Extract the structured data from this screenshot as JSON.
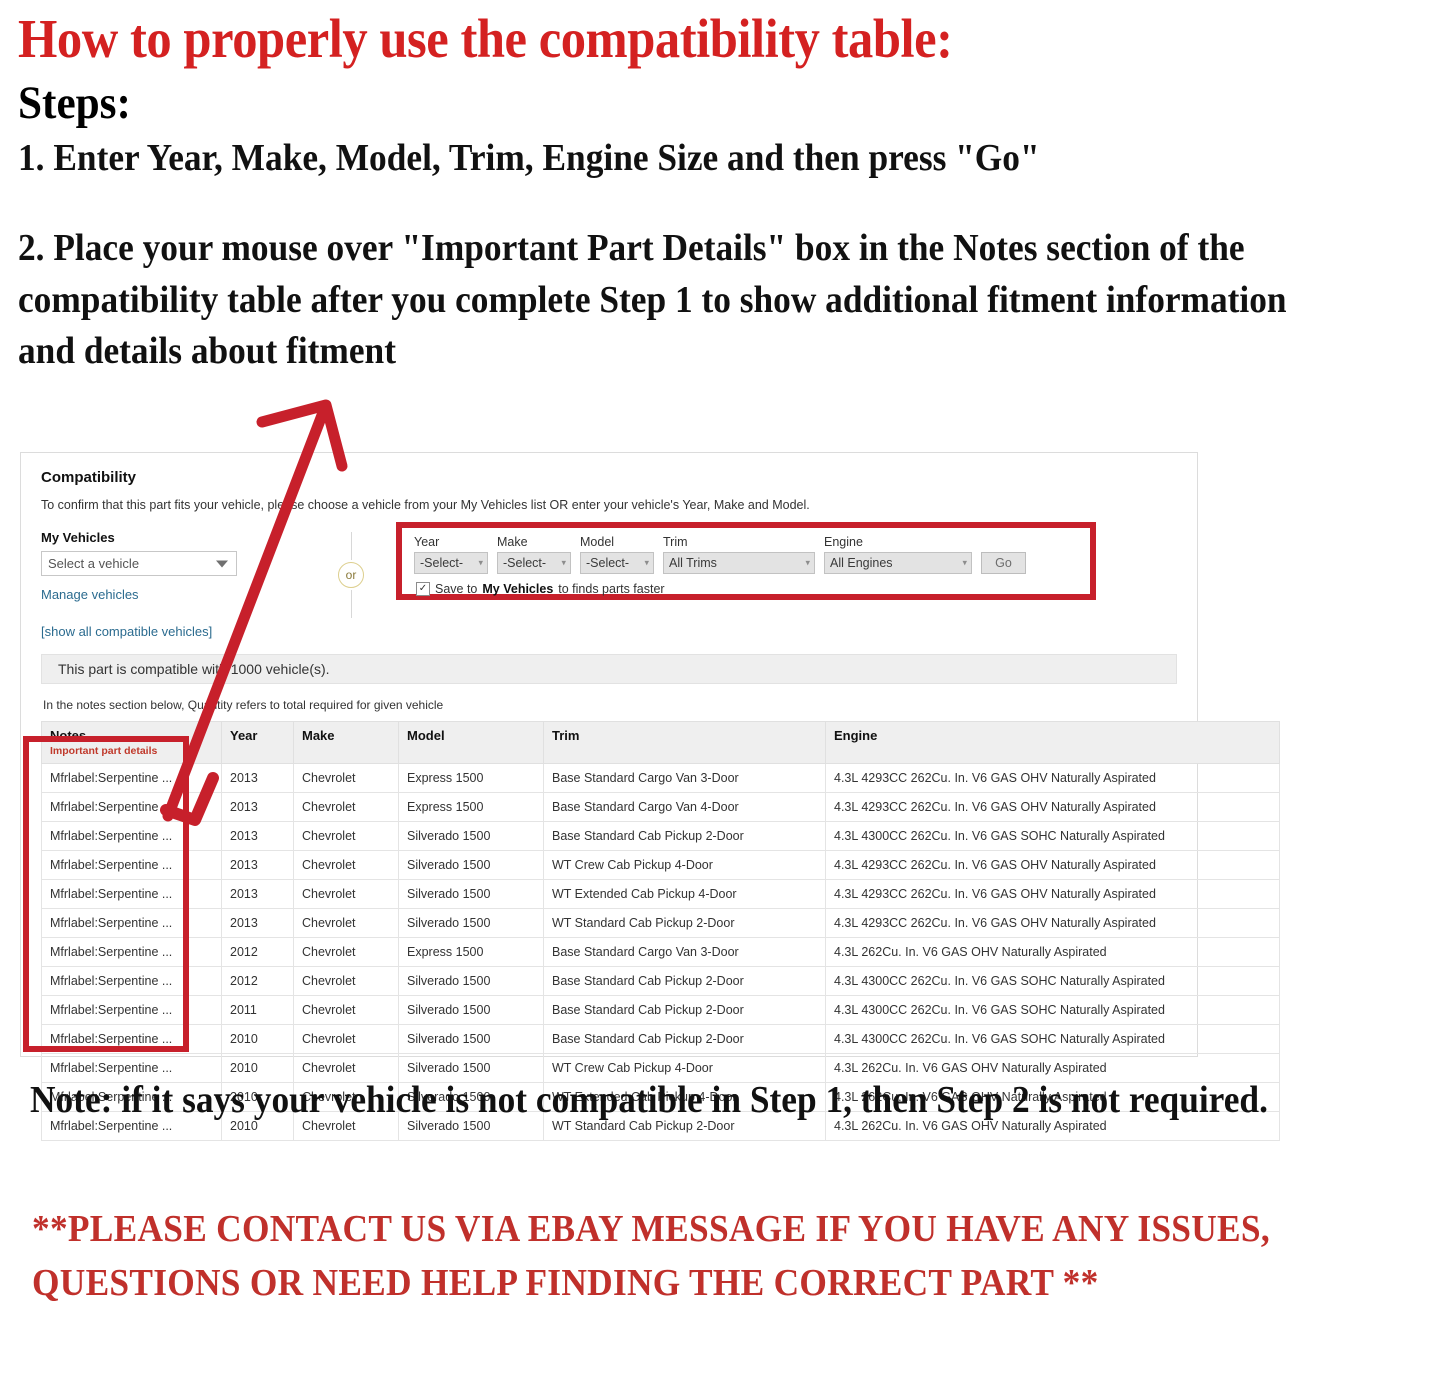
{
  "colors": {
    "title_red": "#d42121",
    "highlight_red": "#c7202b",
    "contact_red": "#c0302b",
    "link_blue": "#2b6b8f",
    "notes_sub_red": "#c0392b"
  },
  "instructions": {
    "title": "How to properly use the compatibility table:",
    "steps_label": "Steps:",
    "step_one": "1. Enter Year, Make, Model, Trim, Engine Size and then press \"Go\"",
    "step_two": "2. Place your mouse over \"Important Part Details\" box in the Notes section of the compatibility table after you complete Step 1 to show additional fitment information and details about fitment"
  },
  "compatibility": {
    "heading": "Compatibility",
    "subheading": "To confirm that this part fits your vehicle, please choose a vehicle from your My Vehicles list OR enter your vehicle's Year, Make and Model.",
    "my_vehicles": {
      "label": "My Vehicles",
      "select_value": "Select a vehicle",
      "manage_link": "Manage vehicles",
      "show_all_link": "[show all compatible vehicles]"
    },
    "or_divider": "or",
    "selector": {
      "year_label": "Year",
      "year_value": "-Select-",
      "make_label": "Make",
      "make_value": "-Select-",
      "model_label": "Model",
      "model_value": "-Select-",
      "trim_label": "Trim",
      "trim_value": "All Trims",
      "engine_label": "Engine",
      "engine_value": "All Engines",
      "go_label": "Go",
      "save_prefix": "Save to ",
      "save_bold": "My Vehicles",
      "save_suffix": " to finds parts faster",
      "checkbox_glyph": "✓"
    },
    "banner": "This part is compatible with 1000 vehicle(s).",
    "quantity_note": "In the notes section below, Quantity refers to total required for given vehicle",
    "table": {
      "headers": [
        "Notes",
        "Year",
        "Make",
        "Model",
        "Trim",
        "Engine"
      ],
      "notes_subheader": "Important part details",
      "rows": [
        [
          "Mfrlabel:Serpentine ...",
          "2013",
          "Chevrolet",
          "Express 1500",
          "Base Standard Cargo Van 3-Door",
          "4.3L 4293CC 262Cu. In. V6 GAS OHV Naturally Aspirated"
        ],
        [
          "Mfrlabel:Serpentine ...",
          "2013",
          "Chevrolet",
          "Express 1500",
          "Base Standard Cargo Van 4-Door",
          "4.3L 4293CC 262Cu. In. V6 GAS OHV Naturally Aspirated"
        ],
        [
          "Mfrlabel:Serpentine ...",
          "2013",
          "Chevrolet",
          "Silverado 1500",
          "Base Standard Cab Pickup 2-Door",
          "4.3L 4300CC 262Cu. In. V6 GAS SOHC Naturally Aspirated"
        ],
        [
          "Mfrlabel:Serpentine ...",
          "2013",
          "Chevrolet",
          "Silverado 1500",
          "WT Crew Cab Pickup 4-Door",
          "4.3L 4293CC 262Cu. In. V6 GAS OHV Naturally Aspirated"
        ],
        [
          "Mfrlabel:Serpentine ...",
          "2013",
          "Chevrolet",
          "Silverado 1500",
          "WT Extended Cab Pickup 4-Door",
          "4.3L 4293CC 262Cu. In. V6 GAS OHV Naturally Aspirated"
        ],
        [
          "Mfrlabel:Serpentine ...",
          "2013",
          "Chevrolet",
          "Silverado 1500",
          "WT Standard Cab Pickup 2-Door",
          "4.3L 4293CC 262Cu. In. V6 GAS OHV Naturally Aspirated"
        ],
        [
          "Mfrlabel:Serpentine ...",
          "2012",
          "Chevrolet",
          "Express 1500",
          "Base Standard Cargo Van 3-Door",
          "4.3L 262Cu. In. V6 GAS OHV Naturally Aspirated"
        ],
        [
          "Mfrlabel:Serpentine ...",
          "2012",
          "Chevrolet",
          "Silverado 1500",
          "Base Standard Cab Pickup 2-Door",
          "4.3L 4300CC 262Cu. In. V6 GAS SOHC Naturally Aspirated"
        ],
        [
          "Mfrlabel:Serpentine ...",
          "2011",
          "Chevrolet",
          "Silverado 1500",
          "Base Standard Cab Pickup 2-Door",
          "4.3L 4300CC 262Cu. In. V6 GAS SOHC Naturally Aspirated"
        ],
        [
          "Mfrlabel:Serpentine ...",
          "2010",
          "Chevrolet",
          "Silverado 1500",
          "Base Standard Cab Pickup 2-Door",
          "4.3L 4300CC 262Cu. In. V6 GAS SOHC Naturally Aspirated"
        ],
        [
          "Mfrlabel:Serpentine ...",
          "2010",
          "Chevrolet",
          "Silverado 1500",
          "WT Crew Cab Pickup 4-Door",
          "4.3L 262Cu. In. V6 GAS OHV Naturally Aspirated"
        ],
        [
          "Mfrlabel:Serpentine ...",
          "2010",
          "Chevrolet",
          "Silverado 1500",
          "WT Extended Cab Pickup 4-Door",
          "4.3L 262Cu. In. V6 GAS OHV Naturally Aspirated"
        ],
        [
          "Mfrlabel:Serpentine ...",
          "2010",
          "Chevrolet",
          "Silverado 1500",
          "WT Standard Cab Pickup 2-Door",
          "4.3L 262Cu. In. V6 GAS OHV Naturally Aspirated"
        ]
      ]
    }
  },
  "footer": {
    "note": "Note: if it says your vehicle is not compatible in Step 1, then Step 2 is not required.",
    "contact": "**PLEASE CONTACT US VIA EBAY MESSAGE IF YOU HAVE ANY ISSUES, QUESTIONS OR NEED HELP FINDING THE CORRECT PART **"
  }
}
